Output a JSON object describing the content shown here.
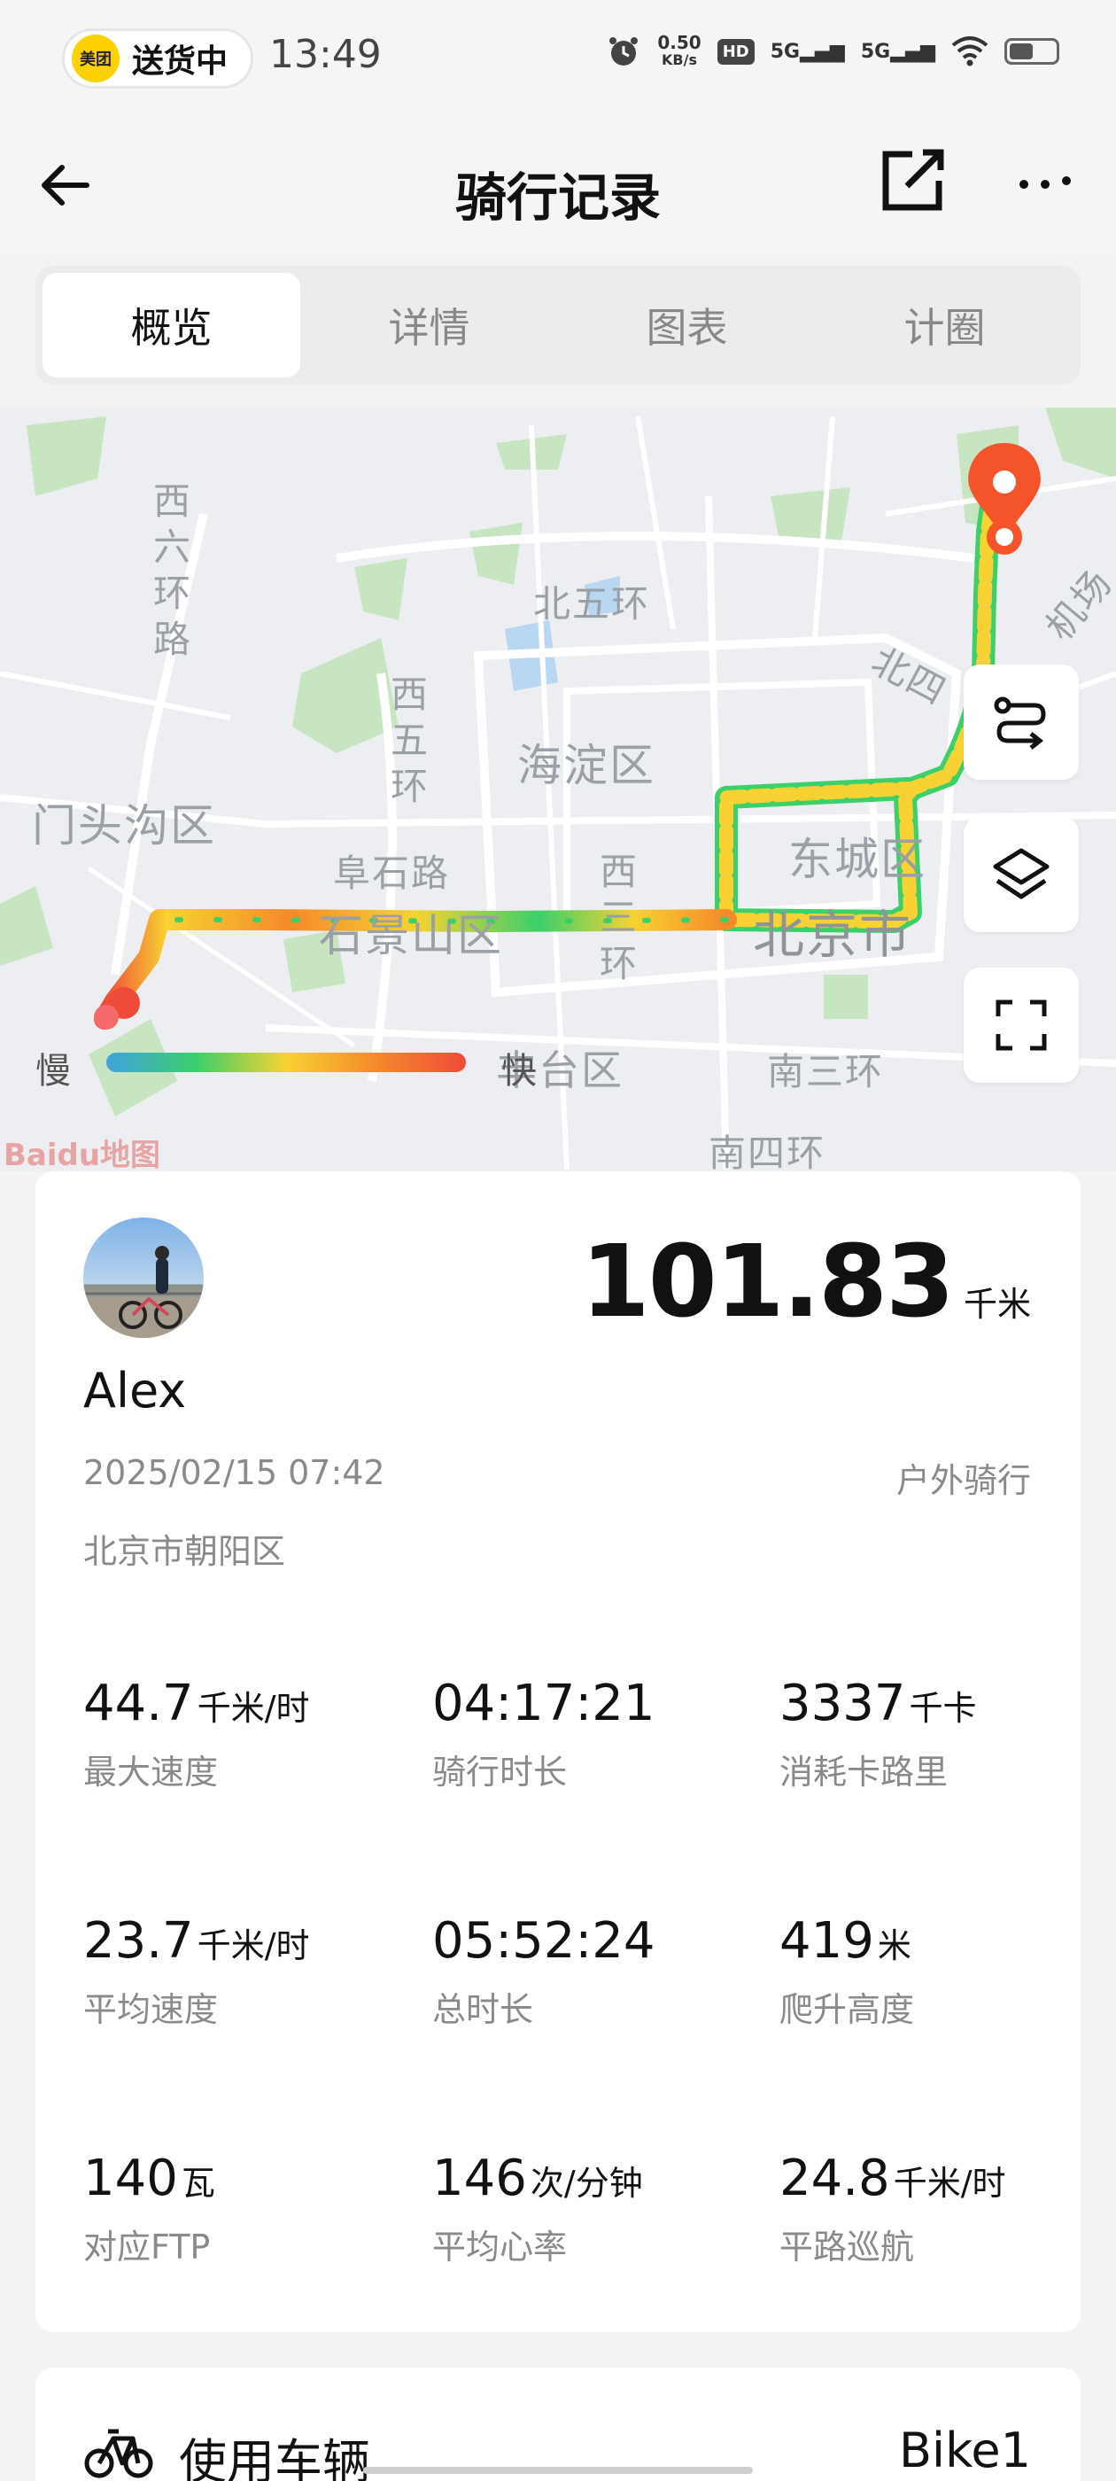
{
  "status_bar": {
    "badge_logo": "美团",
    "badge_text": "送货中",
    "time": "13:49",
    "net_speed_value": "0.50",
    "net_speed_unit": "KB/s",
    "hd_label": "HD",
    "sig1": "5G",
    "sig2": "5G"
  },
  "header": {
    "title": "骑行记录"
  },
  "tabs": [
    {
      "label": "概览",
      "active": true
    },
    {
      "label": "详情",
      "active": false
    },
    {
      "label": "图表",
      "active": false
    },
    {
      "label": "计圈",
      "active": false
    }
  ],
  "map": {
    "labels": {
      "xiliuhuan": "西六环路",
      "beiwuhuan": "北五环",
      "xiwuhuan": "西五环",
      "haidian": "海淀区",
      "mentougou": "门头沟区",
      "fushilu": "阜石路",
      "shijingshan": "石景山区",
      "xisanhuan": "西三环",
      "dongcheng": "东城区",
      "beijingshi": "北京市",
      "beisi": "北四",
      "jichang": "机场",
      "fengtai": "丰台区",
      "nansanhuan": "南三环",
      "nansihuan": "南四环",
      "baidu": "Baidu地图"
    },
    "legend_slow": "慢",
    "legend_fast": "快",
    "route_colors": [
      "#3ccf6a",
      "#f7d232",
      "#f58a2a",
      "#ef4b3a"
    ]
  },
  "ride": {
    "distance": "101.83",
    "distance_unit": "千米",
    "username": "Alex",
    "datetime": "2025/02/15 07:42",
    "ride_type": "户外骑行",
    "location": "北京市朝阳区"
  },
  "stats": [
    {
      "value": "44.7",
      "unit": "千米/时",
      "label": "最大速度"
    },
    {
      "value": "04:17:21",
      "unit": "",
      "label": "骑行时长"
    },
    {
      "value": "3337",
      "unit": "千卡",
      "label": "消耗卡路里"
    },
    {
      "value": "23.7",
      "unit": "千米/时",
      "label": "平均速度"
    },
    {
      "value": "05:52:24",
      "unit": "",
      "label": "总时长"
    },
    {
      "value": "419",
      "unit": "米",
      "label": "爬升高度"
    },
    {
      "value": "140",
      "unit": "瓦",
      "label": "对应FTP"
    },
    {
      "value": "146",
      "unit": "次/分钟",
      "label": "平均心率"
    },
    {
      "value": "24.8",
      "unit": "千米/时",
      "label": "平路巡航"
    }
  ],
  "vehicle": {
    "label": "使用车辆",
    "name": "Bike1"
  }
}
